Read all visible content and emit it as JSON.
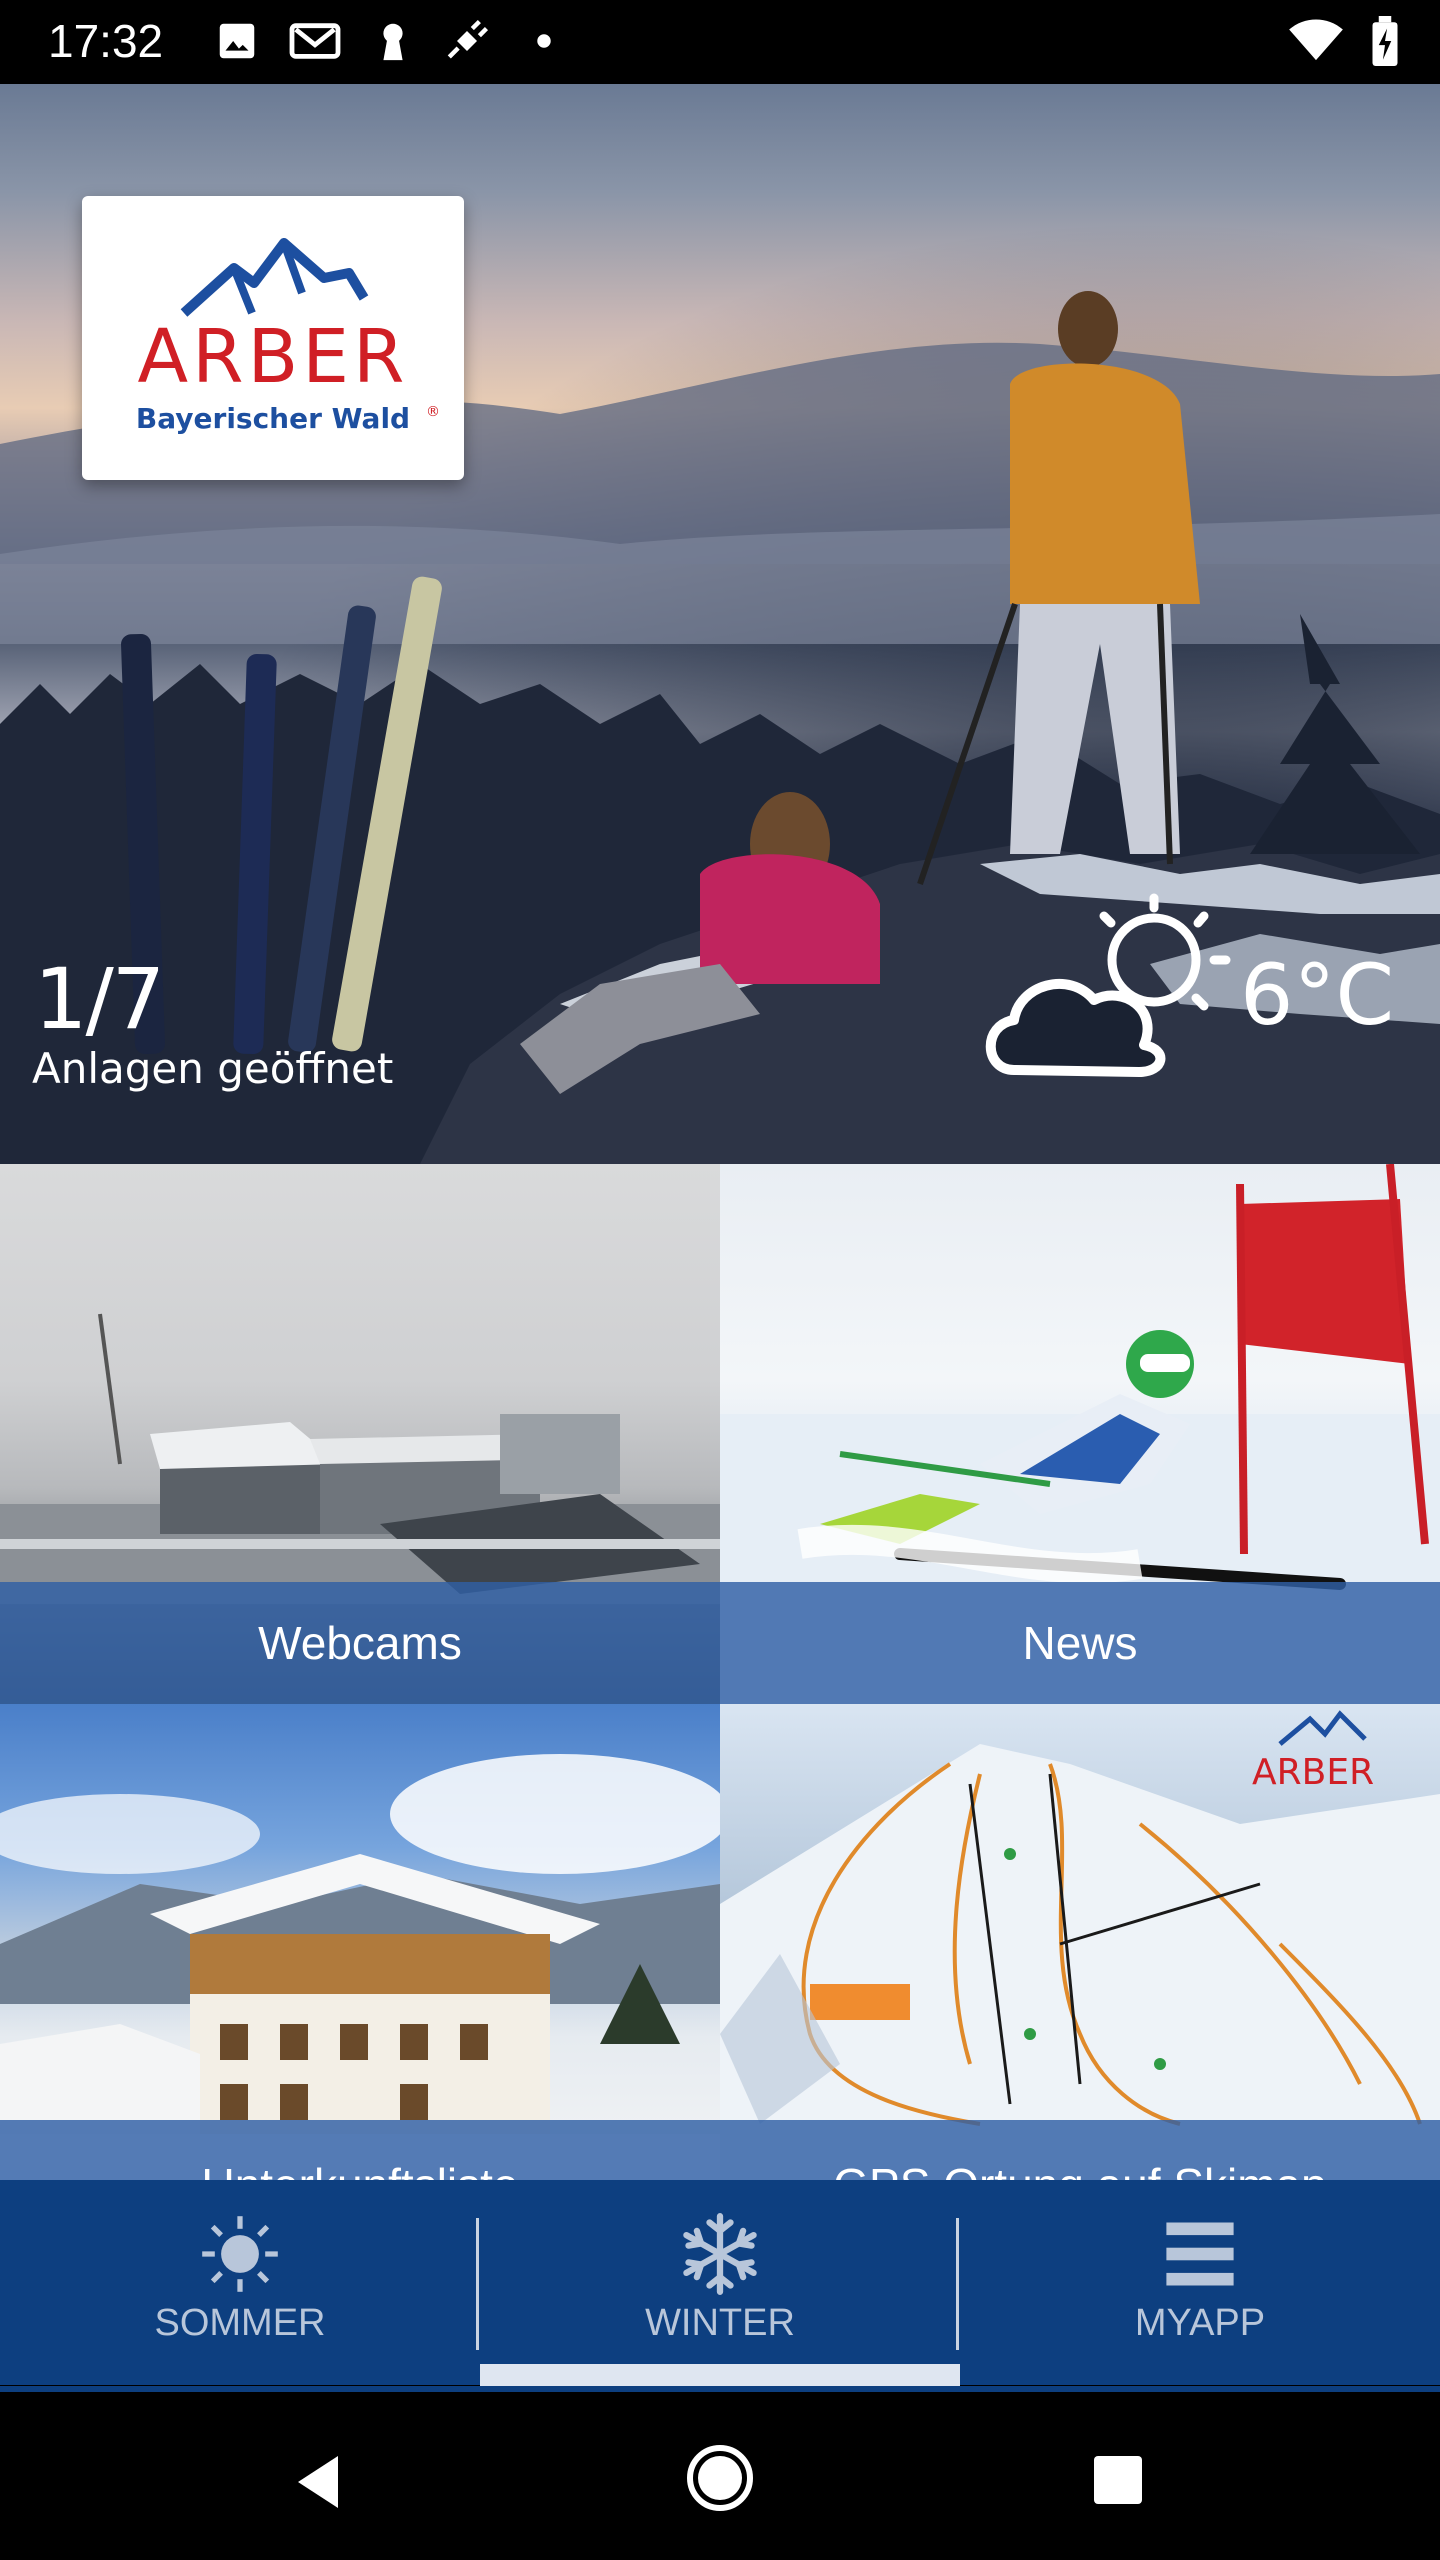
{
  "status_bar": {
    "time": "17:32",
    "icons": [
      "image-icon",
      "gmail-icon",
      "keyhole-icon",
      "satellite-icon",
      "dot-icon"
    ],
    "right_icons": [
      "wifi-icon",
      "battery-icon"
    ]
  },
  "hero": {
    "logo": {
      "brand": "ARBER",
      "subtitle": "Bayerischer Wald",
      "registered": "®"
    },
    "lifts_open_count": "1/7",
    "lifts_open_label": "Anlagen geöffnet",
    "weather_icon": "partly-cloudy-icon",
    "temperature": "6°C"
  },
  "tiles": [
    {
      "label": "Webcams"
    },
    {
      "label": "News"
    },
    {
      "label": "Unterkunftsliste"
    },
    {
      "label": "GPS Ortung auf Skimap"
    }
  ],
  "bottom_nav": {
    "items": [
      {
        "label": "SOMMER",
        "icon": "sun-icon",
        "active": false
      },
      {
        "label": "WINTER",
        "icon": "snowflake-icon",
        "active": true
      },
      {
        "label": "MYAPP",
        "icon": "menu-icon",
        "active": false
      }
    ]
  },
  "system_nav": [
    "back-icon",
    "home-icon",
    "recents-icon"
  ],
  "colors": {
    "brand_red": "#d01f25",
    "brand_blue": "#1d4fa0",
    "nav_background": "#0d3f80",
    "caption_overlay": "#2f5fa5"
  }
}
